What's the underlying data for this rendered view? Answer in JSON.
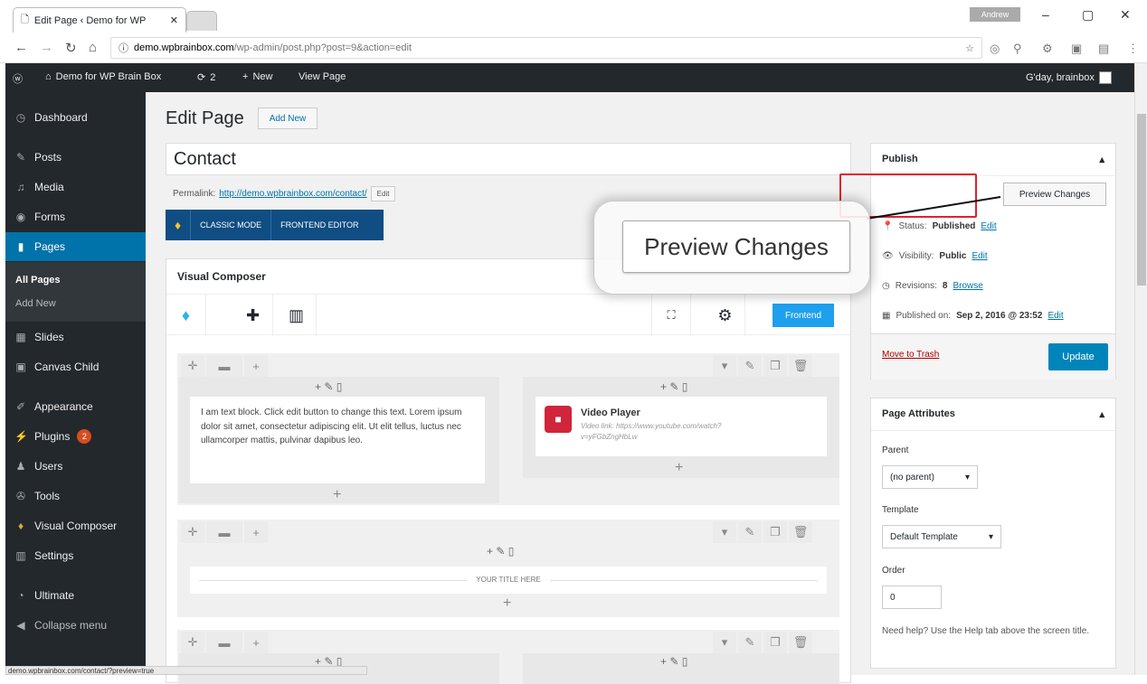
{
  "browser": {
    "tab_title": "Edit Page ‹ Demo for WP",
    "profile": "Andrew",
    "url_domain": "demo.wpbrainbox.com",
    "url_path": "/wp-admin/post.php?post=9&action=edit",
    "status_url": "demo.wpbrainbox.com/contact/?preview=true"
  },
  "adminbar": {
    "site": "Demo for WP Brain Box",
    "updates": "2",
    "new": "New",
    "view": "View Page",
    "greeting": "G'day, brainbox"
  },
  "sidebar": {
    "items": [
      {
        "label": "Dashboard"
      },
      {
        "label": "Posts"
      },
      {
        "label": "Media"
      },
      {
        "label": "Forms"
      },
      {
        "label": "Pages"
      },
      {
        "label": "Slides"
      },
      {
        "label": "Canvas Child"
      },
      {
        "label": "Appearance"
      },
      {
        "label": "Plugins"
      },
      {
        "label": "Users"
      },
      {
        "label": "Tools"
      },
      {
        "label": "Visual Composer"
      },
      {
        "label": "Settings"
      },
      {
        "label": "Ultimate"
      },
      {
        "label": "Collapse menu"
      }
    ],
    "plugins_badge": "2",
    "sub": [
      "All Pages",
      "Add New"
    ]
  },
  "editor": {
    "heading": "Edit Page",
    "add_new": "Add New",
    "title_value": "Contact",
    "permalink_label": "Permalink:",
    "permalink_url": "http://demo.wpbrainbox.com/contact/",
    "edit_btn": "Edit",
    "classic_mode": "CLASSIC MODE",
    "frontend_editor": "FRONTEND EDITOR"
  },
  "vc": {
    "title": "Visual Composer",
    "frontend_btn": "Frontend",
    "text_block": "I am text block. Click edit button to change this text. Lorem ipsum dolor sit amet, consectetur adipiscing elit. Ut elit tellus, luctus nec ullamcorper mattis, pulvinar dapibus leo.",
    "video_title": "Video Player",
    "video_link": "Video link: https://www.youtube.com/watch?v=yFGbZngHbLw",
    "your_title": "YOUR TITLE HERE"
  },
  "publish": {
    "title": "Publish",
    "preview": "Preview Changes",
    "status_label": "Status:",
    "status_value": "Published",
    "visibility_label": "Visibility:",
    "visibility_value": "Public",
    "revisions_label": "Revisions:",
    "revisions_value": "8",
    "browse": "Browse",
    "published_label": "Published on:",
    "published_value": "Sep 2, 2016 @ 23:52",
    "edit": "Edit",
    "trash": "Move to Trash",
    "update": "Update"
  },
  "callout": {
    "label": "Preview Changes"
  },
  "attributes": {
    "title": "Page Attributes",
    "parent_label": "Parent",
    "parent_value": "(no parent)",
    "template_label": "Template",
    "template_value": "Default Template",
    "order_label": "Order",
    "order_value": "0",
    "help": "Need help? Use the Help tab above the screen title."
  }
}
